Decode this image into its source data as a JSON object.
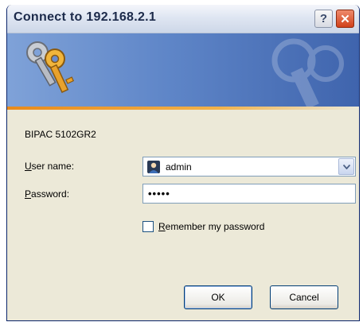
{
  "window": {
    "title": "Connect to 192.168.2.1",
    "help_label": "?",
    "close_label": "✕"
  },
  "banner": {
    "icon": "keys-icon"
  },
  "form": {
    "device_name": "BIPAC 5102GR2",
    "username_label_u": "U",
    "username_label_rest": "ser name:",
    "username_value": "admin",
    "password_label_u": "P",
    "password_label_rest": "assword:",
    "password_value": "•••••",
    "remember_label_u": "R",
    "remember_label_rest": "emember my password",
    "remember_checked": false
  },
  "buttons": {
    "ok_label": "OK",
    "cancel_label": "Cancel"
  },
  "colors": {
    "banner_start": "#7fa2d8",
    "banner_end": "#3f64ad",
    "accent_stripe": "#e98a1a",
    "close_button": "#d1411b"
  }
}
